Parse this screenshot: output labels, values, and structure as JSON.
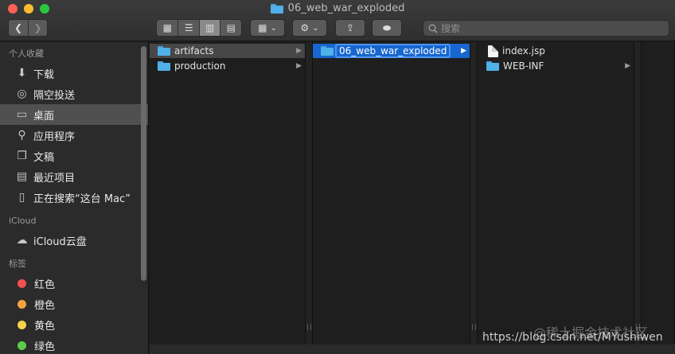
{
  "window": {
    "title": "06_web_war_exploded"
  },
  "toolbar": {
    "back_glyph": "❮",
    "forward_glyph": "❯",
    "view_icons": [
      "▦",
      "☰",
      "▥",
      "▤"
    ],
    "arrange_glyph": "▦",
    "action_glyph": "⚙",
    "dropdown_glyph": "⌄",
    "share_glyph": "⇪",
    "tag_glyph": "⬬"
  },
  "search": {
    "placeholder": "搜索",
    "icon": "search-icon"
  },
  "sidebar": {
    "sections": [
      {
        "header": "个人收藏",
        "items": [
          {
            "label": "下载",
            "icon": "download-icon",
            "glyph": "⬇"
          },
          {
            "label": "隔空投送",
            "icon": "airdrop-icon",
            "glyph": "◎"
          },
          {
            "label": "桌面",
            "icon": "desktop-icon",
            "glyph": "▭",
            "selected": true
          },
          {
            "label": "应用程序",
            "icon": "applications-icon",
            "glyph": "⚲"
          },
          {
            "label": "文稿",
            "icon": "documents-icon",
            "glyph": "❐"
          },
          {
            "label": "最近项目",
            "icon": "recents-icon",
            "glyph": "▤"
          },
          {
            "label": "正在搜索“这台 Mac”",
            "icon": "smart-folder-icon",
            "glyph": "▯"
          }
        ]
      },
      {
        "header": "iCloud",
        "items": [
          {
            "label": "iCloud云盘",
            "icon": "cloud-icon",
            "glyph": "☁"
          }
        ]
      },
      {
        "header": "标签",
        "tags": [
          {
            "label": "红色",
            "color": "#f0504f"
          },
          {
            "label": "橙色",
            "color": "#f5a243"
          },
          {
            "label": "黄色",
            "color": "#f6d14a"
          },
          {
            "label": "绿色",
            "color": "#5ccd4b"
          }
        ]
      }
    ]
  },
  "columns": [
    {
      "items": [
        {
          "name": "artifacts",
          "type": "folder",
          "has_children": true,
          "highlighted": true
        },
        {
          "name": "production",
          "type": "folder",
          "has_children": true
        }
      ]
    },
    {
      "items": [
        {
          "name": "06_web_war_exploded",
          "type": "folder",
          "has_children": true,
          "selected": true
        }
      ]
    },
    {
      "items": [
        {
          "name": "index.jsp",
          "type": "file",
          "has_children": false
        },
        {
          "name": "WEB-INF",
          "type": "folder",
          "has_children": true
        }
      ]
    }
  ],
  "chevron_glyph": "▶",
  "colors": {
    "selection": "#1866d0",
    "folder": "#4fb0ea",
    "sidebar_selected": "#505050"
  },
  "watermark": {
    "url_text": "https://blog.csdn.net/MYushiwen",
    "brand_text": "@稀土掘金技术社区"
  }
}
